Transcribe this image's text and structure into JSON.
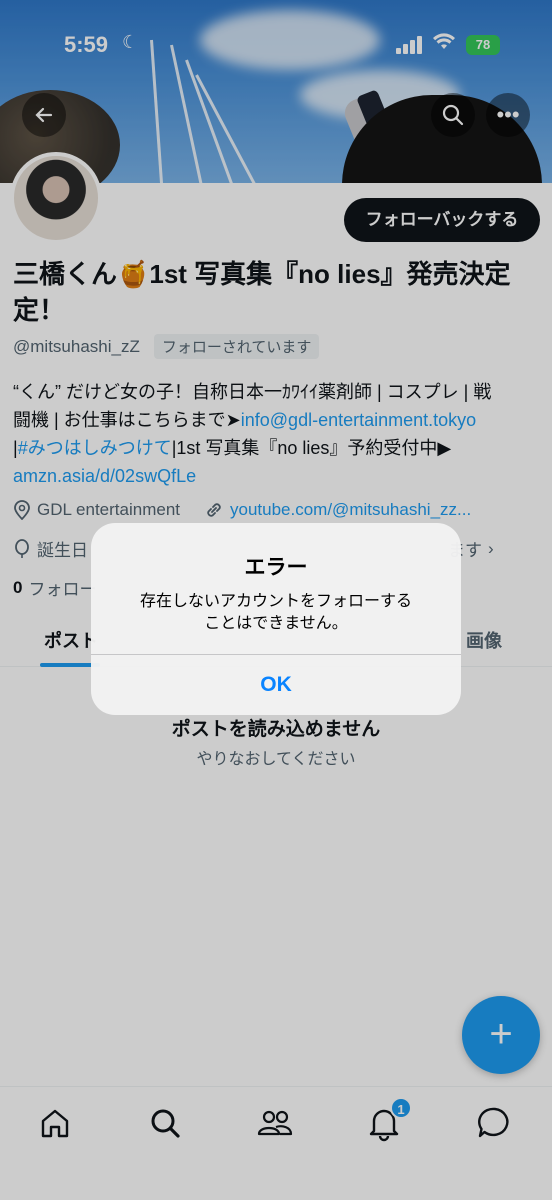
{
  "status_bar": {
    "time": "5:59",
    "battery": "78"
  },
  "profile": {
    "name_line1": "三橋くん🍯1st 写真集『no lies』発売決定",
    "name_line2": "定！",
    "handle": "@mitsuhashi_zZ",
    "follows_you_badge": "フォローされています",
    "follow_back_label": "フォローバックする",
    "bio": {
      "line1": "“くん” だけど女の子！自称日本一ｶﾜｲｲ薬剤師 | コスプレ | 戦",
      "line2_prefix": "闘機 | お仕事はこちらまで➤",
      "email_link": "info@gdl-entertainment.tokyo",
      "line3_prefix": "|",
      "hashtag": "#みつはしみつけて",
      "line3_suffix": "|1st 写真集『no lies』予約受付中▶",
      "amazon_link": "amzn.asia/d/02swQfLe"
    },
    "location": "GDL entertainment",
    "website": "youtube.com/@mitsuhashi_zz...",
    "birthday_label": "誕生日",
    "joined_suffix": "ます",
    "following_count": "0",
    "following_label": "フォロー"
  },
  "tabs": [
    {
      "label": "ポスト"
    },
    {
      "label": "画像"
    }
  ],
  "empty_state": {
    "title": "ポストを読み込めません",
    "subtitle": "やりなおしてください"
  },
  "alert": {
    "title": "エラー",
    "message_line1": "存在しないアカウントをフォローする",
    "message_line2": "ことはできません。",
    "ok_label": "OK"
  },
  "bottom_nav": {
    "items": [
      "home-icon",
      "search-icon",
      "people-icon",
      "bell-icon",
      "messages-icon"
    ],
    "notification_count": "1"
  },
  "colors": {
    "accent": "#1d9bf0",
    "dark": "#0f1419",
    "secondary": "#536471",
    "alert_button": "#0a84ff"
  }
}
